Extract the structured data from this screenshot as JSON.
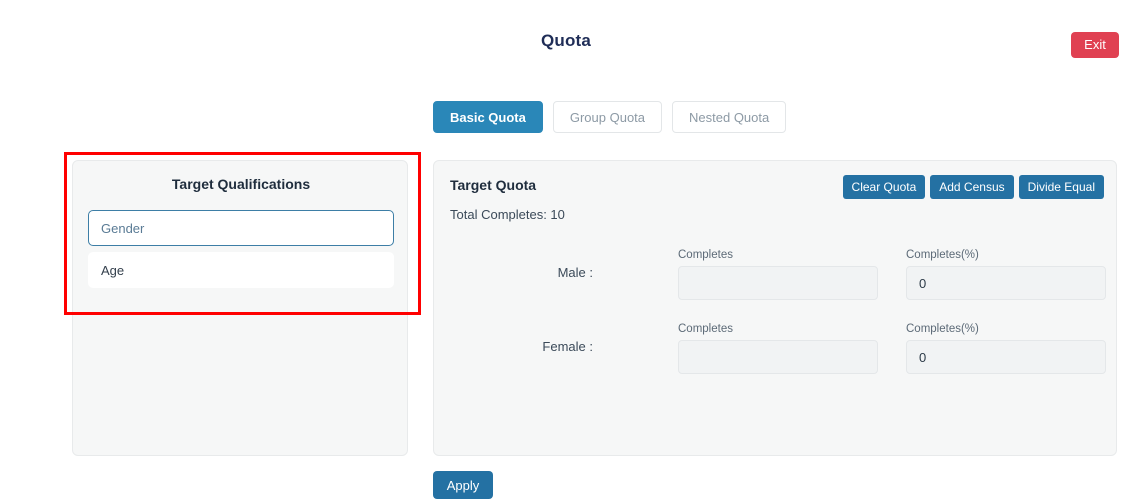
{
  "header": {
    "title": "Quota",
    "exit_label": "Exit"
  },
  "tabs": [
    {
      "label": "Basic Quota",
      "active": true
    },
    {
      "label": "Group Quota",
      "active": false
    },
    {
      "label": "Nested Quota",
      "active": false
    }
  ],
  "left_panel": {
    "title": "Target Qualifications",
    "items": [
      {
        "label": "Gender",
        "selected": true
      },
      {
        "label": "Age",
        "selected": false
      }
    ]
  },
  "right_panel": {
    "title": "Target Quota",
    "total_completes": "Total Completes: 10",
    "actions": [
      {
        "label": "Clear Quota"
      },
      {
        "label": "Add Census"
      },
      {
        "label": "Divide Equal"
      }
    ],
    "rows": [
      {
        "label": "Male :",
        "completes_label": "Completes",
        "completes_value": "",
        "percent_label": "Completes(%)",
        "percent_value": "0"
      },
      {
        "label": "Female :",
        "completes_label": "Completes",
        "completes_value": "",
        "percent_label": "Completes(%)",
        "percent_value": "0"
      }
    ]
  },
  "footer": {
    "apply_label": "Apply"
  },
  "colors": {
    "tab_active": "#2a87b8",
    "action_button": "#2471a3",
    "exit_button": "#e04152",
    "annotation": "#ff0000",
    "card_background": "#f6f7f7"
  }
}
